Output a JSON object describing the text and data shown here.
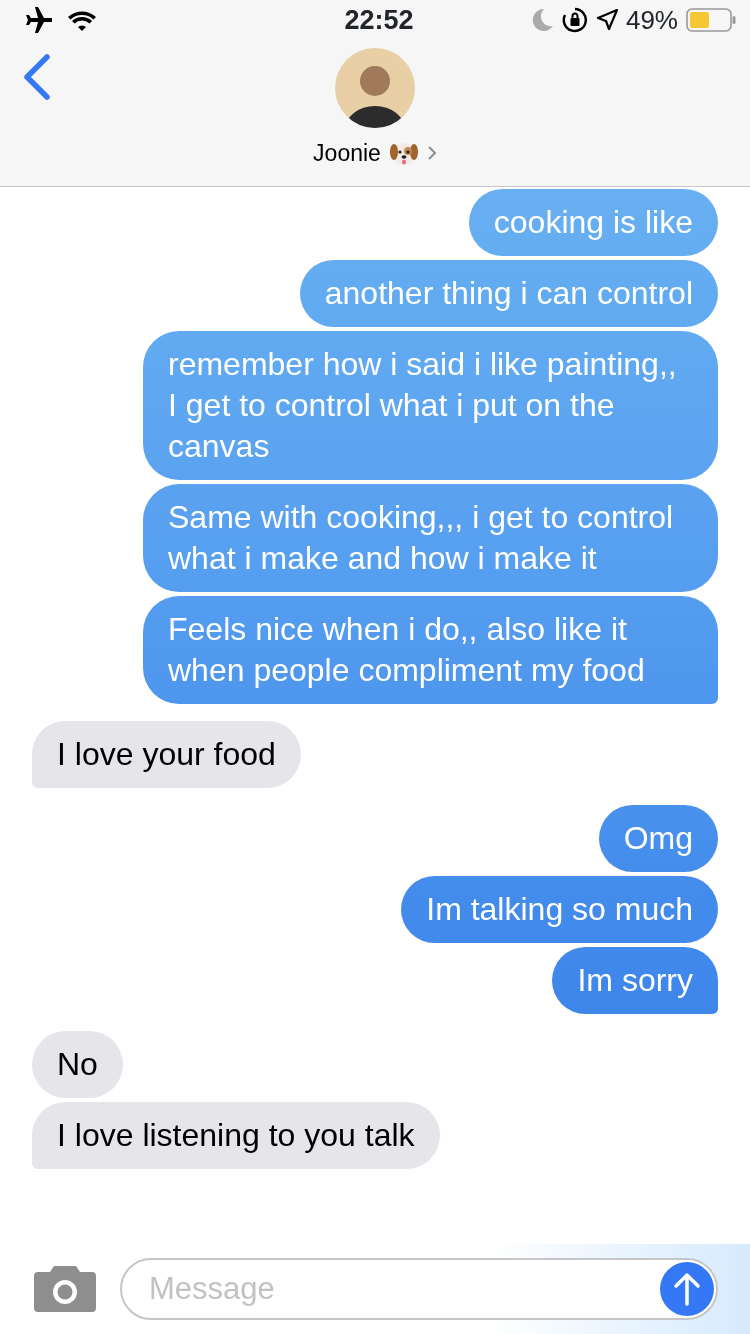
{
  "status_bar": {
    "time": "22:52",
    "battery": "49%"
  },
  "header": {
    "contact_name": "Joonie"
  },
  "messages": [
    {
      "kind": "sent",
      "text": "cooking is like",
      "tail": false
    },
    {
      "kind": "sent",
      "text": "another thing i can control",
      "tail": false
    },
    {
      "kind": "sent",
      "text": "remember how i said i like painting,, I get to control what i put on the canvas",
      "tail": false
    },
    {
      "kind": "sent",
      "text": "Same with cooking,,, i get to control what i make and how i make it",
      "tail": false
    },
    {
      "kind": "sent",
      "text": "Feels nice when i do,, also like it when people compliment my food",
      "tail": true
    },
    {
      "kind": "received",
      "text": "I love your food",
      "tail": true
    },
    {
      "kind": "sent",
      "text": "Omg",
      "tail": false
    },
    {
      "kind": "sent",
      "text": "Im talking so much",
      "tail": false
    },
    {
      "kind": "sent",
      "text": "Im sorry",
      "tail": true
    },
    {
      "kind": "received",
      "text": "No",
      "tail": false
    },
    {
      "kind": "received",
      "text": "I love listening to you talk",
      "tail": true
    }
  ],
  "composer": {
    "placeholder": "Message"
  }
}
